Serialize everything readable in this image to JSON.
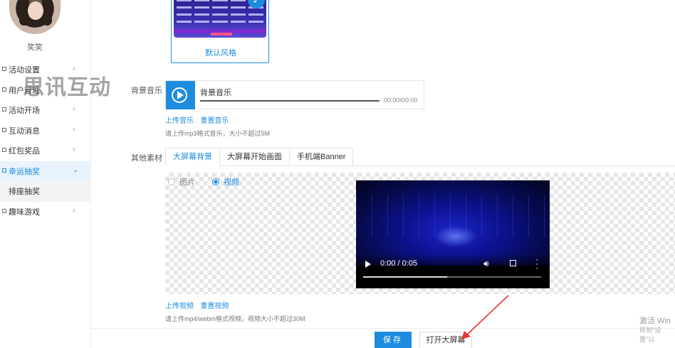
{
  "sidebar": {
    "username": "笑笑",
    "items": [
      {
        "label": "活动设置",
        "icon": "settings-icon",
        "has_chevron": true
      },
      {
        "label": "用户管理",
        "icon": "user-icon",
        "has_chevron": true
      },
      {
        "label": "活动开场",
        "icon": "flag-icon",
        "has_chevron": true
      },
      {
        "label": "互动消息",
        "icon": "message-icon",
        "has_chevron": true
      },
      {
        "label": "红包奖品",
        "icon": "gift-icon",
        "has_chevron": true
      },
      {
        "label": "幸运抽奖",
        "icon": "lottery-icon",
        "has_chevron": true,
        "expanded": true,
        "active": true
      },
      {
        "label": "排座抽奖",
        "sub": true
      },
      {
        "label": "趣味游戏",
        "icon": "game-icon",
        "has_chevron": true
      }
    ]
  },
  "watermark": "思讯互动",
  "theme": {
    "label": "默认风格",
    "selected": true
  },
  "music": {
    "field_label": "背景音乐",
    "title": "背景音乐",
    "time": "00:00/00:00",
    "upload_link": "上传音乐",
    "reset_link": "重置音乐",
    "hint": "请上传mp3格式音乐，大小不超过5M"
  },
  "materials": {
    "field_label": "其他素材",
    "tabs": [
      "大屏幕背景",
      "大屏幕开始画面",
      "手机端Banner"
    ],
    "active_tab": 0,
    "radio_options": [
      "图片",
      "视频"
    ],
    "radio_selected": 1,
    "video": {
      "time": "0:00 / 0:05",
      "progress": 0.47
    },
    "upload_link": "上传视频",
    "reset_link": "重置视频",
    "hint": "请上传mp4/webm格式视频，视频大小不超过30M"
  },
  "actions": {
    "save_label": "保存",
    "open_screen_label": "打开大屏幕"
  },
  "activation": {
    "line1": "激活 Win",
    "line2": "转到\"设置\"以"
  },
  "colors": {
    "accent": "#1d8ce0",
    "annotation_arrow": "#e53935"
  }
}
